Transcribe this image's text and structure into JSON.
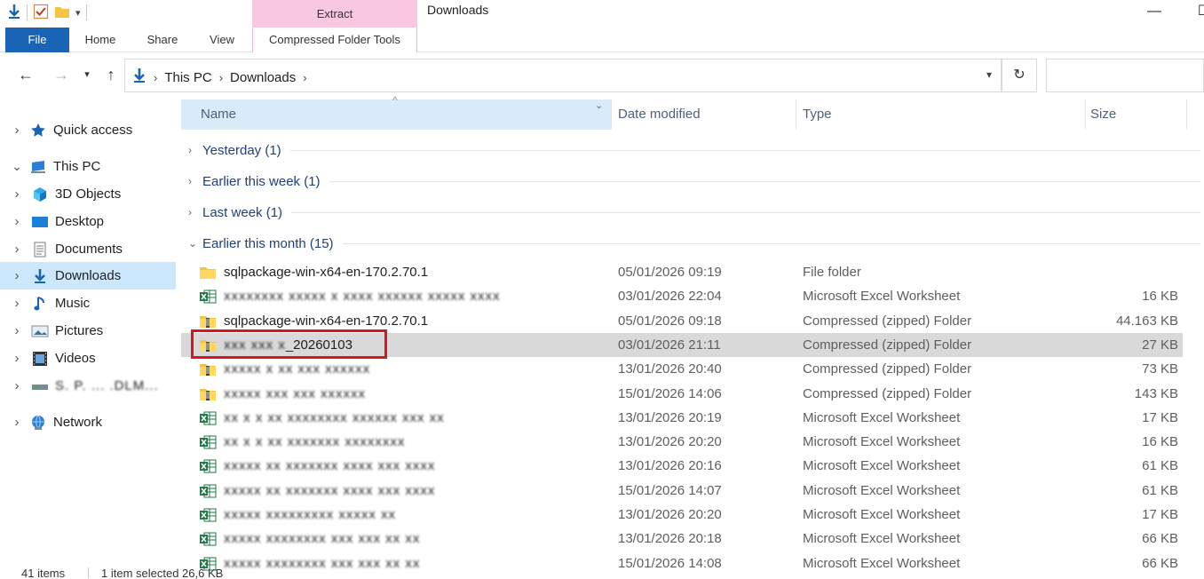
{
  "window": {
    "title": "Downloads",
    "contextual_tab": "Extract",
    "minimize": "—",
    "maximize": "☐"
  },
  "ribbon": {
    "tabs": [
      "File",
      "Home",
      "Share",
      "View",
      "Compressed Folder Tools"
    ]
  },
  "address": {
    "crumbs": [
      "This PC",
      "Downloads"
    ],
    "search_placeholder": ""
  },
  "nav": {
    "items": [
      {
        "label": "Quick access",
        "icon": "star-icon",
        "indent": 0,
        "expander": ">"
      },
      {
        "label": "This PC",
        "icon": "computer-icon",
        "indent": 0,
        "expander": "v"
      },
      {
        "label": "3D Objects",
        "icon": "cube-icon",
        "indent": 1,
        "expander": ">"
      },
      {
        "label": "Desktop",
        "icon": "desktop-icon",
        "indent": 1,
        "expander": ">"
      },
      {
        "label": "Documents",
        "icon": "document-icon",
        "indent": 1,
        "expander": ">"
      },
      {
        "label": "Downloads",
        "icon": "download-icon",
        "indent": 1,
        "expander": ">",
        "selected": true
      },
      {
        "label": "Music",
        "icon": "music-icon",
        "indent": 1,
        "expander": ">"
      },
      {
        "label": "Pictures",
        "icon": "pictures-icon",
        "indent": 1,
        "expander": ">"
      },
      {
        "label": "Videos",
        "icon": "video-icon",
        "indent": 1,
        "expander": ">"
      },
      {
        "label": "S. P. ... .DLM...",
        "icon": "drive-icon",
        "indent": 1,
        "expander": ">",
        "blurred": true
      },
      {
        "label": "Network",
        "icon": "network-icon",
        "indent": 0,
        "expander": ">"
      }
    ]
  },
  "columns": {
    "name": "Name",
    "date": "Date modified",
    "type": "Type",
    "size": "Size"
  },
  "groups": [
    {
      "label": "Yesterday (1)",
      "expanded": false
    },
    {
      "label": "Earlier this week (1)",
      "expanded": false
    },
    {
      "label": "Last week (1)",
      "expanded": false
    },
    {
      "label": "Earlier this month (15)",
      "expanded": true
    }
  ],
  "files": [
    {
      "name": "sqlpackage-win-x64-en-170.2.70.1",
      "date": "05/01/2026 09:19",
      "type": "File folder",
      "size": "",
      "icon": "folder-icon"
    },
    {
      "name": "xxxxxxxx xxxxx x xxxx xxxxxx xxxxx xxxx",
      "date": "03/01/2026 22:04",
      "type": "Microsoft Excel Worksheet",
      "size": "16 KB",
      "icon": "excel-icon",
      "blurred": true
    },
    {
      "name": "sqlpackage-win-x64-en-170.2.70.1",
      "date": "05/01/2026 09:18",
      "type": "Compressed (zipped) Folder",
      "size": "44.163 KB",
      "icon": "zip-icon"
    },
    {
      "name": "_20260103",
      "name_prefix": "xxx xxx x",
      "date": "03/01/2026 21:11",
      "type": "Compressed (zipped) Folder",
      "size": "27 KB",
      "icon": "zip-icon",
      "selected": true
    },
    {
      "name": "xxxxx x xx xxx xxxxxx",
      "date": "13/01/2026 20:40",
      "type": "Compressed (zipped) Folder",
      "size": "73 KB",
      "icon": "zip-icon",
      "blurred": true
    },
    {
      "name": "xxxxx xxx xxx xxxxxx",
      "date": "15/01/2026 14:06",
      "type": "Compressed (zipped) Folder",
      "size": "143 KB",
      "icon": "zip-icon",
      "blurred": true
    },
    {
      "name": "xx x x xx xxxxxxxx xxxxxx xxx xx",
      "date": "13/01/2026 20:19",
      "type": "Microsoft Excel Worksheet",
      "size": "17 KB",
      "icon": "excel-icon",
      "blurred": true
    },
    {
      "name": "xx x x xx xxxxxxx xxxxxxxx",
      "date": "13/01/2026 20:20",
      "type": "Microsoft Excel Worksheet",
      "size": "16 KB",
      "icon": "excel-icon",
      "blurred": true
    },
    {
      "name": "xxxxx xx xxxxxxx xxxx xxx xxxx",
      "date": "13/01/2026 20:16",
      "type": "Microsoft Excel Worksheet",
      "size": "61 KB",
      "icon": "excel-icon",
      "blurred": true
    },
    {
      "name": "xxxxx xx xxxxxxx xxxx xxx xxxx",
      "date": "15/01/2026 14:07",
      "type": "Microsoft Excel Worksheet",
      "size": "61 KB",
      "icon": "excel-icon",
      "blurred": true
    },
    {
      "name": "xxxxx xxxxxxxxx xxxxx xx",
      "date": "13/01/2026 20:20",
      "type": "Microsoft Excel Worksheet",
      "size": "17 KB",
      "icon": "excel-icon",
      "blurred": true
    },
    {
      "name": "xxxxx xxxxxxxx xxx xxx xx xx",
      "date": "13/01/2026 20:18",
      "type": "Microsoft Excel Worksheet",
      "size": "66 KB",
      "icon": "excel-icon",
      "blurred": true
    },
    {
      "name": "xxxxx xxxxxxxx xxx xxx xx xx",
      "date": "15/01/2026 14:08",
      "type": "Microsoft Excel Worksheet",
      "size": "66 KB",
      "icon": "excel-icon",
      "blurred": true
    }
  ],
  "status": {
    "items": "41 items",
    "selection": "1 item selected  26,6 KB"
  },
  "colors": {
    "file_tab": "#1a64b5",
    "contextual": "#f7c8e0",
    "nav_selected": "#cce8ff",
    "row_selected": "#d9d9d9",
    "group_text": "#1e3f80",
    "highlight_box": "#d9161d"
  }
}
